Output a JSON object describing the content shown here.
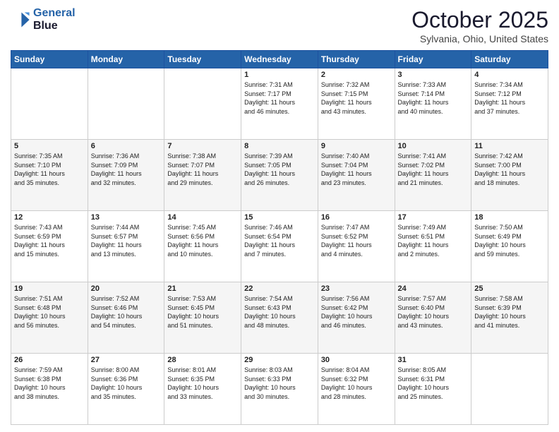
{
  "header": {
    "logo_line1": "General",
    "logo_line2": "Blue",
    "month": "October 2025",
    "location": "Sylvania, Ohio, United States"
  },
  "days_of_week": [
    "Sunday",
    "Monday",
    "Tuesday",
    "Wednesday",
    "Thursday",
    "Friday",
    "Saturday"
  ],
  "weeks": [
    [
      {
        "day": "",
        "info": ""
      },
      {
        "day": "",
        "info": ""
      },
      {
        "day": "",
        "info": ""
      },
      {
        "day": "1",
        "info": "Sunrise: 7:31 AM\nSunset: 7:17 PM\nDaylight: 11 hours\nand 46 minutes."
      },
      {
        "day": "2",
        "info": "Sunrise: 7:32 AM\nSunset: 7:15 PM\nDaylight: 11 hours\nand 43 minutes."
      },
      {
        "day": "3",
        "info": "Sunrise: 7:33 AM\nSunset: 7:14 PM\nDaylight: 11 hours\nand 40 minutes."
      },
      {
        "day": "4",
        "info": "Sunrise: 7:34 AM\nSunset: 7:12 PM\nDaylight: 11 hours\nand 37 minutes."
      }
    ],
    [
      {
        "day": "5",
        "info": "Sunrise: 7:35 AM\nSunset: 7:10 PM\nDaylight: 11 hours\nand 35 minutes."
      },
      {
        "day": "6",
        "info": "Sunrise: 7:36 AM\nSunset: 7:09 PM\nDaylight: 11 hours\nand 32 minutes."
      },
      {
        "day": "7",
        "info": "Sunrise: 7:38 AM\nSunset: 7:07 PM\nDaylight: 11 hours\nand 29 minutes."
      },
      {
        "day": "8",
        "info": "Sunrise: 7:39 AM\nSunset: 7:05 PM\nDaylight: 11 hours\nand 26 minutes."
      },
      {
        "day": "9",
        "info": "Sunrise: 7:40 AM\nSunset: 7:04 PM\nDaylight: 11 hours\nand 23 minutes."
      },
      {
        "day": "10",
        "info": "Sunrise: 7:41 AM\nSunset: 7:02 PM\nDaylight: 11 hours\nand 21 minutes."
      },
      {
        "day": "11",
        "info": "Sunrise: 7:42 AM\nSunset: 7:00 PM\nDaylight: 11 hours\nand 18 minutes."
      }
    ],
    [
      {
        "day": "12",
        "info": "Sunrise: 7:43 AM\nSunset: 6:59 PM\nDaylight: 11 hours\nand 15 minutes."
      },
      {
        "day": "13",
        "info": "Sunrise: 7:44 AM\nSunset: 6:57 PM\nDaylight: 11 hours\nand 13 minutes."
      },
      {
        "day": "14",
        "info": "Sunrise: 7:45 AM\nSunset: 6:56 PM\nDaylight: 11 hours\nand 10 minutes."
      },
      {
        "day": "15",
        "info": "Sunrise: 7:46 AM\nSunset: 6:54 PM\nDaylight: 11 hours\nand 7 minutes."
      },
      {
        "day": "16",
        "info": "Sunrise: 7:47 AM\nSunset: 6:52 PM\nDaylight: 11 hours\nand 4 minutes."
      },
      {
        "day": "17",
        "info": "Sunrise: 7:49 AM\nSunset: 6:51 PM\nDaylight: 11 hours\nand 2 minutes."
      },
      {
        "day": "18",
        "info": "Sunrise: 7:50 AM\nSunset: 6:49 PM\nDaylight: 10 hours\nand 59 minutes."
      }
    ],
    [
      {
        "day": "19",
        "info": "Sunrise: 7:51 AM\nSunset: 6:48 PM\nDaylight: 10 hours\nand 56 minutes."
      },
      {
        "day": "20",
        "info": "Sunrise: 7:52 AM\nSunset: 6:46 PM\nDaylight: 10 hours\nand 54 minutes."
      },
      {
        "day": "21",
        "info": "Sunrise: 7:53 AM\nSunset: 6:45 PM\nDaylight: 10 hours\nand 51 minutes."
      },
      {
        "day": "22",
        "info": "Sunrise: 7:54 AM\nSunset: 6:43 PM\nDaylight: 10 hours\nand 48 minutes."
      },
      {
        "day": "23",
        "info": "Sunrise: 7:56 AM\nSunset: 6:42 PM\nDaylight: 10 hours\nand 46 minutes."
      },
      {
        "day": "24",
        "info": "Sunrise: 7:57 AM\nSunset: 6:40 PM\nDaylight: 10 hours\nand 43 minutes."
      },
      {
        "day": "25",
        "info": "Sunrise: 7:58 AM\nSunset: 6:39 PM\nDaylight: 10 hours\nand 41 minutes."
      }
    ],
    [
      {
        "day": "26",
        "info": "Sunrise: 7:59 AM\nSunset: 6:38 PM\nDaylight: 10 hours\nand 38 minutes."
      },
      {
        "day": "27",
        "info": "Sunrise: 8:00 AM\nSunset: 6:36 PM\nDaylight: 10 hours\nand 35 minutes."
      },
      {
        "day": "28",
        "info": "Sunrise: 8:01 AM\nSunset: 6:35 PM\nDaylight: 10 hours\nand 33 minutes."
      },
      {
        "day": "29",
        "info": "Sunrise: 8:03 AM\nSunset: 6:33 PM\nDaylight: 10 hours\nand 30 minutes."
      },
      {
        "day": "30",
        "info": "Sunrise: 8:04 AM\nSunset: 6:32 PM\nDaylight: 10 hours\nand 28 minutes."
      },
      {
        "day": "31",
        "info": "Sunrise: 8:05 AM\nSunset: 6:31 PM\nDaylight: 10 hours\nand 25 minutes."
      },
      {
        "day": "",
        "info": ""
      }
    ]
  ]
}
